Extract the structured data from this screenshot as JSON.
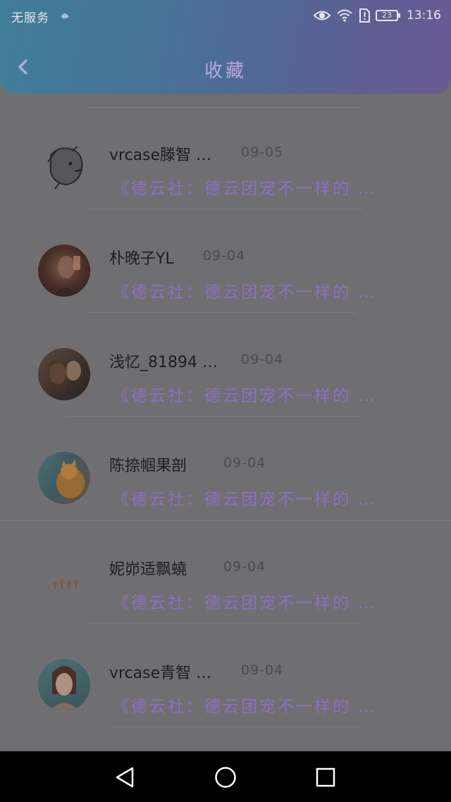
{
  "status_bar": {
    "carrier": "无服务",
    "battery": "23",
    "time": "13:16"
  },
  "header": {
    "title": "收藏"
  },
  "favorites": [
    {
      "name": "vrcase滕智 …",
      "date": "09-05",
      "preview": "《德云社：德云团宠不一样的 …",
      "avatar": "lion"
    },
    {
      "name": "朴晚子YL",
      "date": "09-04",
      "preview": "《德云社：德云团宠不一样的 …",
      "avatar": "girl-dark"
    },
    {
      "name": "浅忆_81894 …",
      "date": "09-04",
      "preview": "《德云社：德云团宠不一样的 …",
      "avatar": "two-girls"
    },
    {
      "name": "陈捺帼果剖",
      "date": "09-04",
      "preview": "《德云社：德云团宠不一样的 …",
      "avatar": "cat"
    },
    {
      "name": "妮峁适飘蟯",
      "date": "09-04",
      "preview": "《德云社：德云团宠不一样的 …",
      "avatar": "leaves"
    },
    {
      "name": "vrcase青智 …",
      "date": "09-04",
      "preview": "《德云社：德云团宠不一样的 …",
      "avatar": "woman"
    }
  ],
  "colors": {
    "header_start": "#3f7e99",
    "header_end": "#6b5a94",
    "preview_text": "#8e6fc4",
    "overlay_bg": "#6f6f71"
  }
}
